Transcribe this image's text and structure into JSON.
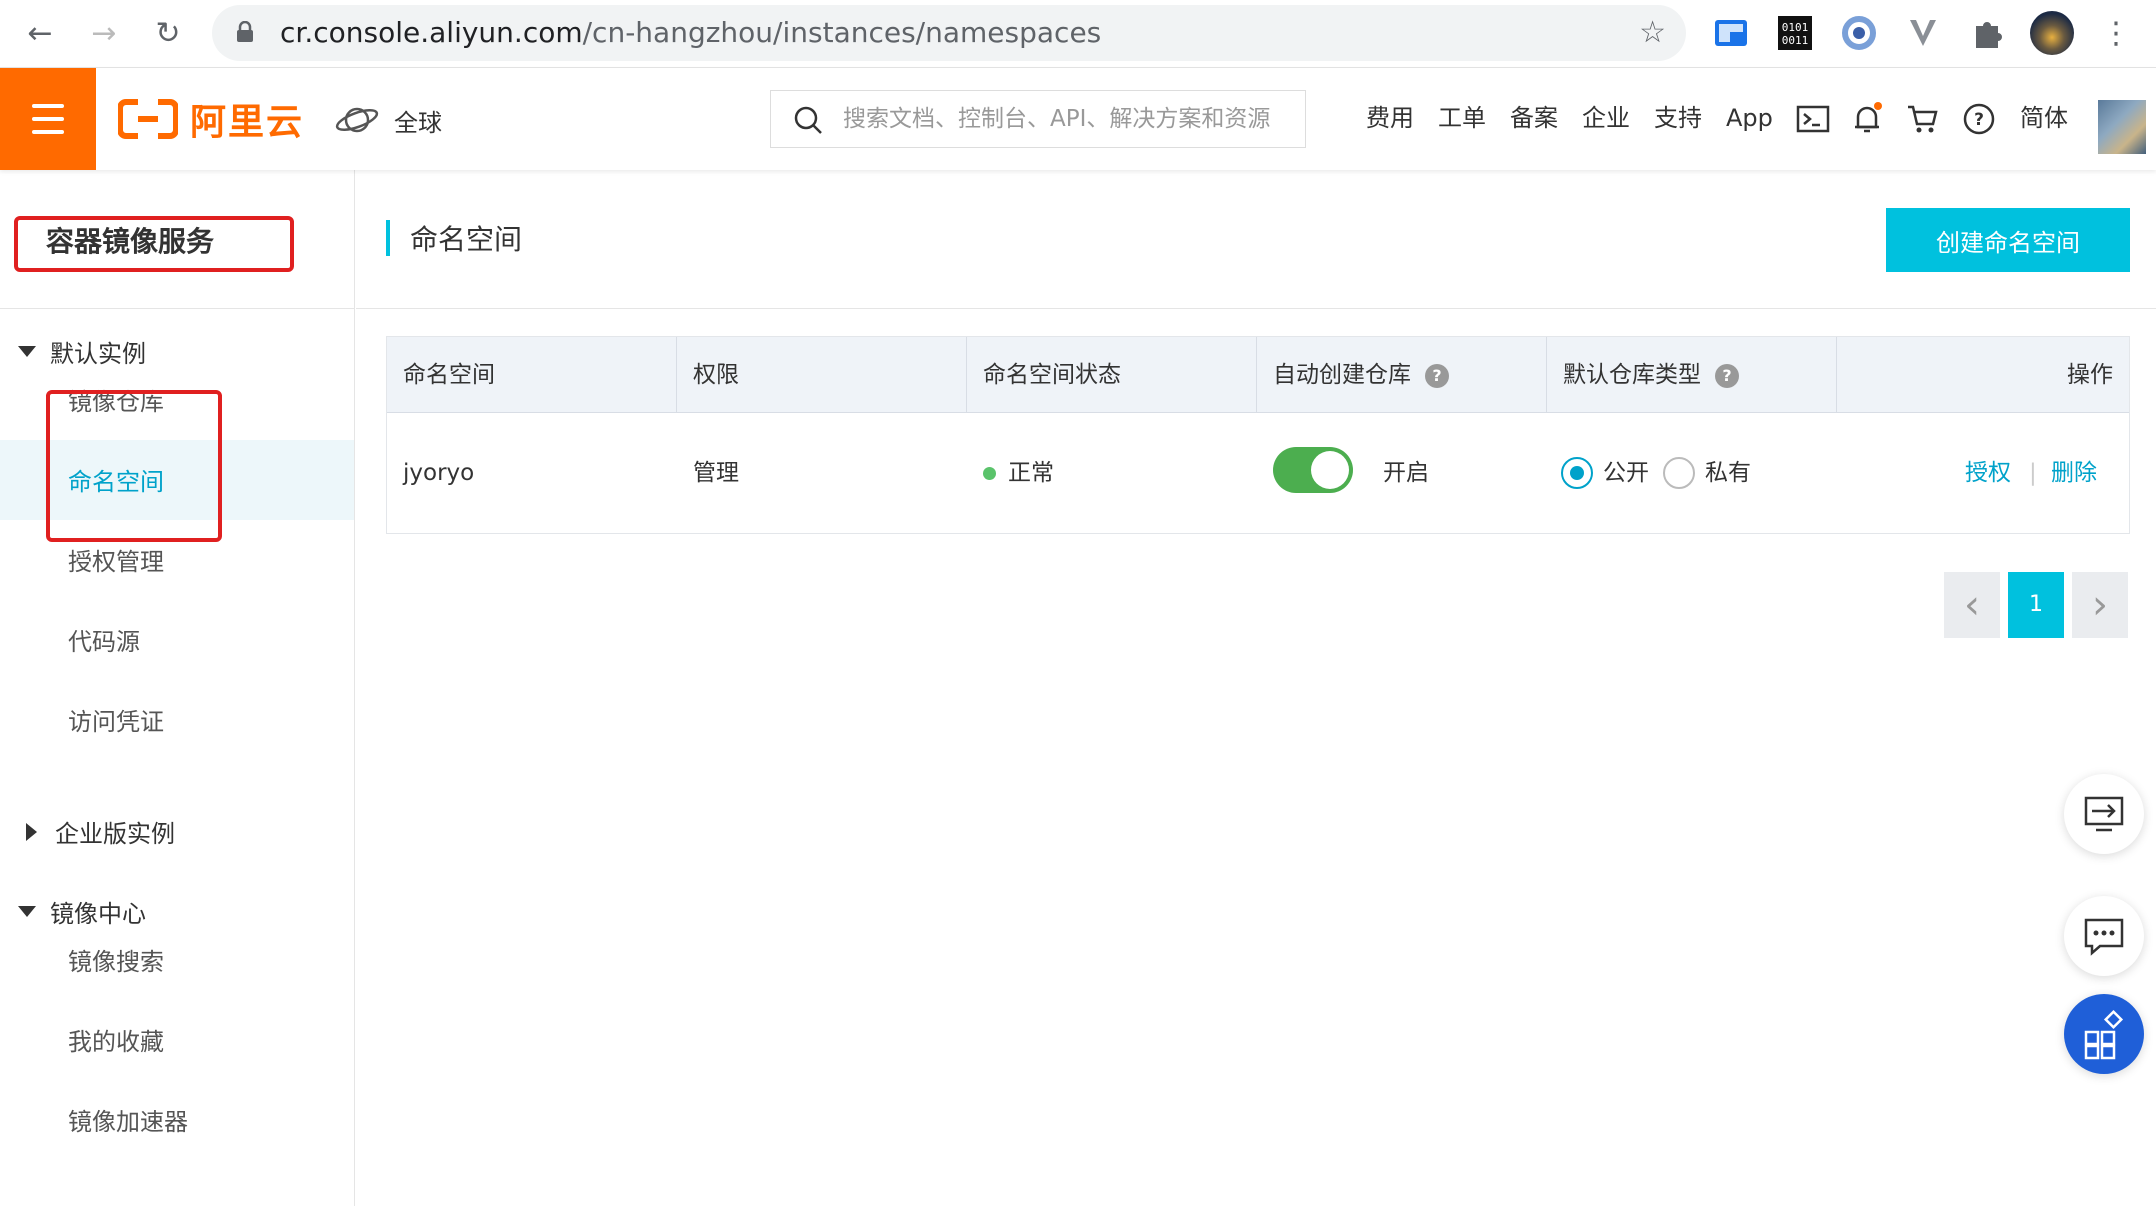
{
  "browser": {
    "url_host": "cr.console.aliyun.com",
    "url_path": "/cn-hangzhou/instances/namespaces"
  },
  "header": {
    "logo_text": "阿里云",
    "region_label": "全球",
    "search_placeholder": "搜索文档、控制台、API、解决方案和资源",
    "links": [
      "费用",
      "工单",
      "备案",
      "企业",
      "支持",
      "App"
    ],
    "lang": "简体"
  },
  "sidebar": {
    "title": "容器镜像服务",
    "groups": [
      {
        "label": "默认实例",
        "expanded": true,
        "items": [
          "镜像仓库",
          "命名空间",
          "授权管理",
          "代码源",
          "访问凭证"
        ]
      },
      {
        "label": "企业版实例",
        "expanded": false,
        "items": []
      },
      {
        "label": "镜像中心",
        "expanded": true,
        "items": [
          "镜像搜索",
          "我的收藏",
          "镜像加速器"
        ]
      }
    ],
    "active_item": "命名空间"
  },
  "main": {
    "title": "命名空间",
    "create_button": "创建命名空间",
    "table": {
      "headers": [
        "命名空间",
        "权限",
        "命名空间状态",
        "自动创建仓库",
        "默认仓库类型",
        "操作"
      ],
      "rows": [
        {
          "namespace": "jyoryo",
          "permission": "管理",
          "status": "正常",
          "auto_create": "开启",
          "repo_type_public": "公开",
          "repo_type_private": "私有",
          "op_authorize": "授权",
          "op_separator": "|",
          "op_delete": "删除"
        }
      ]
    },
    "pagination": {
      "current_page": "1"
    }
  },
  "colors": {
    "brand": "#ff6a00",
    "accent": "#00c1de",
    "link": "#00a2ca",
    "toggle_on": "#4cae4f",
    "highlight_box": "#e02020"
  }
}
